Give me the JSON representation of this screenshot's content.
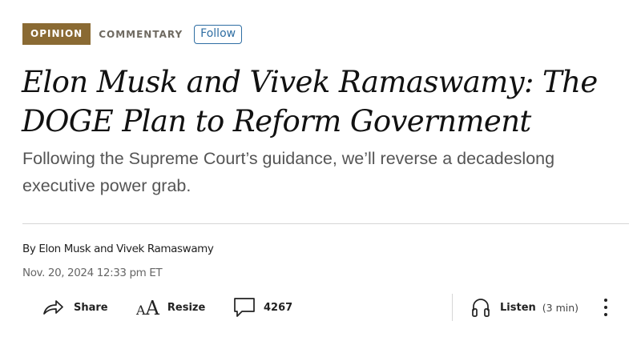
{
  "tagline": {
    "badge": "OPINION",
    "section": "COMMENTARY",
    "follow_label": "Follow"
  },
  "article": {
    "headline": "Elon Musk and Vivek Ramaswamy: The DOGE Plan to Reform Government",
    "dek": "Following the Supreme Court’s guidance, we’ll reverse a decadeslong executive power grab.",
    "byline": "By Elon Musk and Vivek Ramaswamy",
    "timestamp": "Nov. 20, 2024 12:33 pm ET"
  },
  "toolbar": {
    "share": {
      "label": "Share",
      "icon": "share-arrow-icon"
    },
    "resize": {
      "label": "Resize",
      "icon": "text-resize-icon",
      "glyph_small": "A",
      "glyph_big": "A"
    },
    "comments": {
      "count": "4267",
      "icon": "comment-bubble-icon"
    },
    "listen": {
      "label": "Listen",
      "duration": "(3 min)",
      "icon": "headphones-icon"
    },
    "more": {
      "icon": "more-vertical-icon"
    }
  },
  "colors": {
    "badge_bg": "#8a6a33",
    "follow_accent": "#2f6ea3",
    "section_gray": "#6f6a61",
    "dek_gray": "#555555"
  }
}
